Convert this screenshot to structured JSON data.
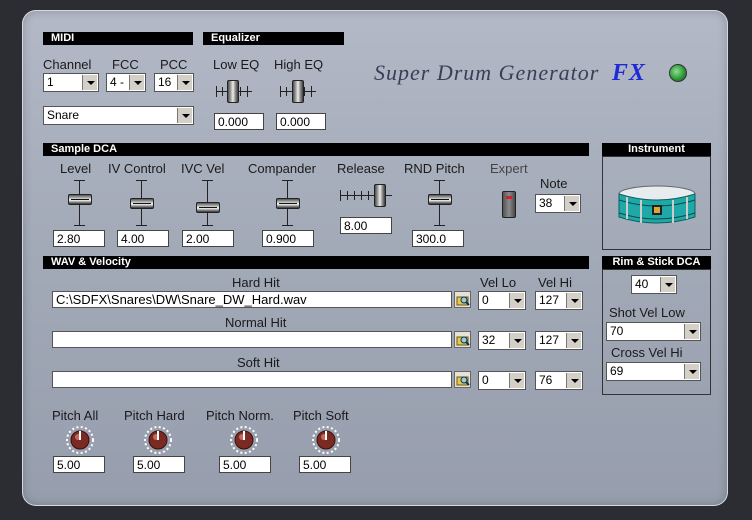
{
  "title": "Super Drum Generator",
  "title_suffix": "FX",
  "sections": {
    "midi": "MIDI",
    "equalizer": "Equalizer",
    "sample_dca": "Sample DCA",
    "instrument": "Instrument",
    "wav_velocity": "WAV & Velocity",
    "rim_stick": "Rim & Stick DCA"
  },
  "midi": {
    "channel_label": "Channel",
    "channel_value": "1",
    "fcc_label": "FCC",
    "fcc_value": "4 -",
    "pcc_label": "PCC",
    "pcc_value": "16",
    "instrument_value": "Snare"
  },
  "eq": {
    "low_label": "Low EQ",
    "low_value": "0.000",
    "high_label": "High EQ",
    "high_value": "0.000"
  },
  "dca": {
    "level_label": "Level",
    "level_value": "2.80",
    "iv_control_label": "IV Control",
    "iv_control_value": "4.00",
    "ivc_vel_label": "IVC Vel",
    "ivc_vel_value": "2.00",
    "compander_label": "Compander",
    "compander_value": "0.900",
    "release_label": "Release",
    "release_value": "8.00",
    "rnd_pitch_label": "RND Pitch",
    "rnd_pitch_value": "300.0",
    "expert_label": "Expert",
    "note_label": "Note",
    "note_value": "38"
  },
  "wav": {
    "hard_label": "Hard Hit",
    "hard_path": "C:\\SDFX\\Snares\\DW\\Snare_DW_Hard.wav",
    "normal_label": "Normal Hit",
    "normal_path": "",
    "soft_label": "Soft Hit",
    "soft_path": "",
    "vel_lo_label": "Vel Lo",
    "vel_hi_label": "Vel Hi",
    "hard_vel_lo": "0",
    "hard_vel_hi": "127",
    "normal_vel_lo": "32",
    "normal_vel_hi": "127",
    "soft_vel_lo": "0",
    "soft_vel_hi": "76"
  },
  "pitch": {
    "all_label": "Pitch All",
    "all_value": "5.00",
    "hard_label": "Pitch Hard",
    "hard_value": "5.00",
    "norm_label": "Pitch Norm.",
    "norm_value": "5.00",
    "soft_label": "Pitch Soft",
    "soft_value": "5.00"
  },
  "rim": {
    "value": "40",
    "shot_vel_low_label": "Shot Vel Low",
    "shot_vel_low_value": "70",
    "cross_vel_hi_label": "Cross Vel Hi",
    "cross_vel_hi_value": "69"
  },
  "colors": {
    "accent_title": "#3a3f55",
    "fx_blue": "#1e2ad8",
    "led_green": "#2f9a3a",
    "drum_teal": "#1ea8a8"
  }
}
